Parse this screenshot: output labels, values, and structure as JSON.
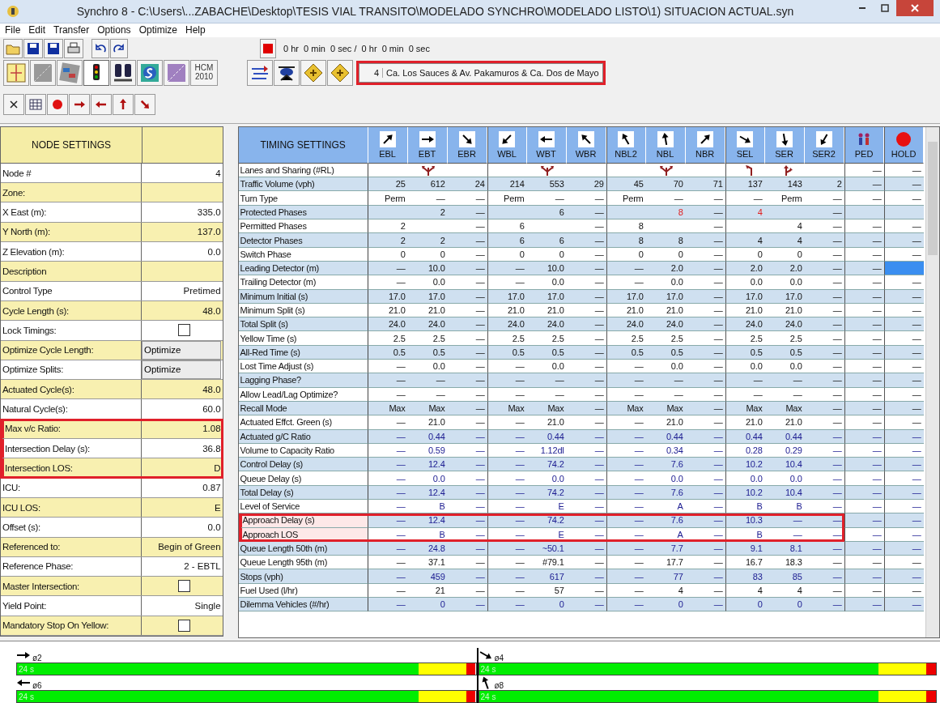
{
  "window": {
    "title": "Synchro 8 - C:\\Users\\...ZABACHE\\Desktop\\TESIS VIAL TRANSITO\\MODELADO SYNCHRO\\MODELADO LISTO\\1) SITUACION ACTUAL.syn"
  },
  "menu": [
    {
      "label": "File"
    },
    {
      "label": "Edit"
    },
    {
      "label": "Transfer"
    },
    {
      "label": "Options"
    },
    {
      "label": "Optimize"
    },
    {
      "label": "Help"
    }
  ],
  "toolbar": {
    "status_time": "0 hr  0 min  0 sec /  0 hr  0 min  0 sec",
    "hcm": "HCM 2010",
    "node_number": "4",
    "node_name": "Ca. Los Sauces & Av. Pakamuros & Ca. Dos de Mayo",
    "node_highlighted": true
  },
  "node_settings": {
    "title": "NODE SETTINGS",
    "rows": [
      {
        "label": "Node #",
        "kind": "value",
        "value": "4",
        "highlighted": false
      },
      {
        "label": "Zone:",
        "kind": "field",
        "highlighted": false
      },
      {
        "label": "X East (m):",
        "kind": "value",
        "value": "335.0",
        "highlighted": false
      },
      {
        "label": "Y North (m):",
        "kind": "value",
        "value": "137.0",
        "highlighted": false
      },
      {
        "label": "Z Elevation (m):",
        "kind": "value",
        "value": "0.0",
        "highlighted": false
      },
      {
        "label": "Description",
        "kind": "field",
        "highlighted": false
      },
      {
        "label": "Control Type",
        "kind": "value",
        "value": "Pretimed",
        "highlighted": false
      },
      {
        "label": "Cycle Length (s):",
        "kind": "value",
        "value": "48.0",
        "highlighted": false
      },
      {
        "label": "Lock Timings:",
        "kind": "checkbox",
        "checked": false,
        "highlighted": false
      },
      {
        "label": "Optimize Cycle Length:",
        "kind": "button",
        "value": "Optimize",
        "highlighted": false
      },
      {
        "label": "Optimize Splits:",
        "kind": "button",
        "value": "Optimize",
        "highlighted": false
      },
      {
        "label": "Actuated Cycle(s):",
        "kind": "value",
        "value": "48.0",
        "highlighted": false
      },
      {
        "label": "Natural Cycle(s):",
        "kind": "value",
        "value": "60.0",
        "highlighted": false
      },
      {
        "label": "Max v/c Ratio:",
        "kind": "value",
        "value": "1.08",
        "highlighted": true
      },
      {
        "label": "Intersection Delay (s):",
        "kind": "value",
        "value": "36.8",
        "highlighted": true
      },
      {
        "label": "Intersection LOS:",
        "kind": "value",
        "value": "D",
        "highlighted": true
      },
      {
        "label": "ICU:",
        "kind": "value",
        "value": "0.87",
        "highlighted": false
      },
      {
        "label": "ICU LOS:",
        "kind": "value",
        "value": "E",
        "highlighted": false
      },
      {
        "label": "Offset (s):",
        "kind": "value",
        "value": "0.0",
        "highlighted": false
      },
      {
        "label": "Referenced to:",
        "kind": "value",
        "value": "Begin of Green",
        "highlighted": false
      },
      {
        "label": "Reference Phase:",
        "kind": "value",
        "value": "2 - EBTL",
        "highlighted": false
      },
      {
        "label": "Master Intersection:",
        "kind": "checkbox",
        "checked": false,
        "highlighted": false
      },
      {
        "label": "Yield Point:",
        "kind": "value",
        "value": "Single",
        "highlighted": false
      },
      {
        "label": "Mandatory Stop On Yellow:",
        "kind": "checkbox",
        "checked": false,
        "highlighted": false
      }
    ]
  },
  "timing": {
    "title": "TIMING SETTINGS",
    "columns": [
      "EBL",
      "EBT",
      "EBR",
      "WBL",
      "WBT",
      "WBR",
      "NBL2",
      "NBL",
      "NBR",
      "SEL",
      "SER",
      "SER2",
      "PED",
      "HOLD"
    ],
    "rows": [
      {
        "label": "Lanes and Sharing (#RL)",
        "calculated": false,
        "highlighted": false,
        "cells": [
          null,
          {
            "kind": "ltr"
          },
          null,
          null,
          {
            "kind": "ltr"
          },
          null,
          null,
          {
            "kind": "ltr"
          },
          null,
          {
            "kind": "l"
          },
          {
            "kind": "tr"
          },
          null,
          "—",
          "—"
        ]
      },
      {
        "label": "Traffic Volume (vph)",
        "calculated": false,
        "highlighted": false,
        "cells": [
          "25",
          "612",
          "24",
          "214",
          "553",
          "29",
          "45",
          "70",
          "71",
          "137",
          "143",
          "2",
          "—",
          "—"
        ]
      },
      {
        "label": "Turn Type",
        "calculated": false,
        "highlighted": false,
        "cells": [
          "Perm",
          "—",
          "—",
          "Perm",
          "—",
          "—",
          "Perm",
          "—",
          "—",
          "—",
          "Perm",
          "—",
          "—",
          "—"
        ]
      },
      {
        "label": "Protected Phases",
        "calculated": false,
        "highlighted": false,
        "cells": [
          null,
          "2",
          "—",
          null,
          "6",
          "—",
          null,
          {
            "text": "8",
            "warning": true
          },
          "—",
          {
            "text": "4",
            "warning": true
          },
          null,
          "—",
          null,
          null
        ]
      },
      {
        "label": "Permitted Phases",
        "calculated": false,
        "highlighted": false,
        "cells": [
          "2",
          null,
          "—",
          "6",
          null,
          "—",
          "8",
          null,
          "—",
          null,
          "4",
          "—",
          "—",
          "—"
        ]
      },
      {
        "label": "Detector Phases",
        "calculated": false,
        "highlighted": false,
        "cells": [
          "2",
          "2",
          "—",
          "6",
          "6",
          "—",
          "8",
          "8",
          "—",
          "4",
          "4",
          "—",
          "—",
          "—"
        ]
      },
      {
        "label": "Switch Phase",
        "calculated": false,
        "highlighted": false,
        "cells": [
          "0",
          "0",
          "—",
          "0",
          "0",
          "—",
          "0",
          "0",
          "—",
          "0",
          "0",
          "—",
          "—",
          "—"
        ]
      },
      {
        "label": "Leading Detector (m)",
        "calculated": false,
        "highlighted": false,
        "cells": [
          "—",
          "10.0",
          "—",
          "—",
          "10.0",
          "—",
          "—",
          "2.0",
          "—",
          "2.0",
          "2.0",
          "—",
          "—",
          {
            "selected": true
          }
        ]
      },
      {
        "label": "Trailing Detector (m)",
        "calculated": false,
        "highlighted": false,
        "cells": [
          "—",
          "0.0",
          "—",
          "—",
          "0.0",
          "—",
          "—",
          "0.0",
          "—",
          "0.0",
          "0.0",
          "—",
          "—",
          "—"
        ]
      },
      {
        "label": "Minimum Initial (s)",
        "calculated": false,
        "highlighted": false,
        "cells": [
          "17.0",
          "17.0",
          "—",
          "17.0",
          "17.0",
          "—",
          "17.0",
          "17.0",
          "—",
          "17.0",
          "17.0",
          "—",
          "—",
          "—"
        ]
      },
      {
        "label": "Minimum Split (s)",
        "calculated": false,
        "highlighted": false,
        "cells": [
          "21.0",
          "21.0",
          "—",
          "21.0",
          "21.0",
          "—",
          "21.0",
          "21.0",
          "—",
          "21.0",
          "21.0",
          "—",
          "—",
          "—"
        ]
      },
      {
        "label": "Total Split (s)",
        "calculated": false,
        "highlighted": false,
        "cells": [
          "24.0",
          "24.0",
          "—",
          "24.0",
          "24.0",
          "—",
          "24.0",
          "24.0",
          "—",
          "24.0",
          "24.0",
          "—",
          "—",
          "—"
        ]
      },
      {
        "label": "Yellow Time (s)",
        "calculated": false,
        "highlighted": false,
        "cells": [
          "2.5",
          "2.5",
          "—",
          "2.5",
          "2.5",
          "—",
          "2.5",
          "2.5",
          "—",
          "2.5",
          "2.5",
          "—",
          "—",
          "—"
        ]
      },
      {
        "label": "All-Red Time (s)",
        "calculated": false,
        "highlighted": false,
        "cells": [
          "0.5",
          "0.5",
          "—",
          "0.5",
          "0.5",
          "—",
          "0.5",
          "0.5",
          "—",
          "0.5",
          "0.5",
          "—",
          "—",
          "—"
        ]
      },
      {
        "label": "Lost Time Adjust (s)",
        "calculated": false,
        "highlighted": false,
        "cells": [
          "—",
          "0.0",
          "—",
          "—",
          "0.0",
          "—",
          "—",
          "0.0",
          "—",
          "0.0",
          "0.0",
          "—",
          "—",
          "—"
        ]
      },
      {
        "label": "Lagging Phase?",
        "calculated": false,
        "highlighted": false,
        "cells": [
          "—",
          "—",
          "—",
          "—",
          "—",
          "—",
          "—",
          "—",
          "—",
          "—",
          "—",
          "—",
          "—",
          "—"
        ]
      },
      {
        "label": "Allow Lead/Lag Optimize?",
        "calculated": false,
        "highlighted": false,
        "cells": [
          "—",
          "—",
          "—",
          "—",
          "—",
          "—",
          "—",
          "—",
          "—",
          "—",
          "—",
          "—",
          "—",
          "—"
        ]
      },
      {
        "label": "Recall Mode",
        "calculated": false,
        "highlighted": false,
        "cells": [
          "Max",
          "Max",
          "—",
          "Max",
          "Max",
          "—",
          "Max",
          "Max",
          "—",
          "Max",
          "Max",
          "—",
          "—",
          "—"
        ]
      },
      {
        "label": "Actuated Effct. Green (s)",
        "calculated": false,
        "highlighted": false,
        "cells": [
          "—",
          "21.0",
          "—",
          "—",
          "21.0",
          "—",
          "—",
          "21.0",
          "—",
          "21.0",
          "21.0",
          "—",
          "—",
          "—"
        ]
      },
      {
        "label": "Actuated g/C Ratio",
        "calculated": true,
        "highlighted": false,
        "cells": [
          "—",
          "0.44",
          "—",
          "—",
          "0.44",
          "—",
          "—",
          "0.44",
          "—",
          "0.44",
          "0.44",
          "—",
          "—",
          "—"
        ]
      },
      {
        "label": "Volume to Capacity Ratio",
        "calculated": true,
        "highlighted": false,
        "cells": [
          "—",
          "0.59",
          "—",
          "—",
          "1.12dl",
          "—",
          "—",
          "0.34",
          "—",
          "0.28",
          "0.29",
          "—",
          "—",
          "—"
        ]
      },
      {
        "label": "Control Delay (s)",
        "calculated": true,
        "highlighted": false,
        "cells": [
          "—",
          "12.4",
          "—",
          "—",
          "74.2",
          "—",
          "—",
          "7.6",
          "—",
          "10.2",
          "10.4",
          "—",
          "—",
          "—"
        ]
      },
      {
        "label": "Queue Delay (s)",
        "calculated": true,
        "highlighted": false,
        "cells": [
          "—",
          "0.0",
          "—",
          "—",
          "0.0",
          "—",
          "—",
          "0.0",
          "—",
          "0.0",
          "0.0",
          "—",
          "—",
          "—"
        ]
      },
      {
        "label": "Total Delay (s)",
        "calculated": true,
        "highlighted": false,
        "cells": [
          "—",
          "12.4",
          "—",
          "—",
          "74.2",
          "—",
          "—",
          "7.6",
          "—",
          "10.2",
          "10.4",
          "—",
          "—",
          "—"
        ]
      },
      {
        "label": "Level of Service",
        "calculated": true,
        "highlighted": false,
        "cells": [
          "—",
          "B",
          "—",
          "—",
          "E",
          "—",
          "—",
          "A",
          "—",
          "B",
          "B",
          "—",
          "—",
          "—"
        ]
      },
      {
        "label": "Approach Delay (s)",
        "calculated": true,
        "highlighted": true,
        "cells": [
          "—",
          "12.4",
          "—",
          "—",
          "74.2",
          "—",
          "—",
          "7.6",
          "—",
          "10.3",
          "—",
          "—",
          "—",
          "—"
        ]
      },
      {
        "label": "Approach LOS",
        "calculated": true,
        "highlighted": true,
        "cells": [
          "—",
          "B",
          "—",
          "—",
          "E",
          "—",
          "—",
          "A",
          "—",
          "B",
          "—",
          "—",
          "—",
          "—"
        ]
      },
      {
        "label": "Queue Length 50th (m)",
        "calculated": true,
        "highlighted": false,
        "cells": [
          "—",
          "24.8",
          "—",
          "—",
          "~50.1",
          "—",
          "—",
          "7.7",
          "—",
          "9.1",
          "8.1",
          "—",
          "—",
          "—"
        ]
      },
      {
        "label": "Queue Length 95th (m)",
        "calculated": false,
        "highlighted": false,
        "cells": [
          "—",
          "37.1",
          "—",
          "—",
          "#79.1",
          "—",
          "—",
          "17.7",
          "—",
          "16.7",
          "18.3",
          "—",
          "—",
          "—"
        ]
      },
      {
        "label": "Stops (vph)",
        "calculated": true,
        "highlighted": false,
        "cells": [
          "—",
          "459",
          "—",
          "—",
          "617",
          "—",
          "—",
          "77",
          "—",
          "83",
          "85",
          "—",
          "—",
          "—"
        ]
      },
      {
        "label": "Fuel Used (l/hr)",
        "calculated": false,
        "highlighted": false,
        "cells": [
          "—",
          "21",
          "—",
          "—",
          "57",
          "—",
          "—",
          "4",
          "—",
          "4",
          "4",
          "—",
          "—",
          "—"
        ]
      },
      {
        "label": "Dilemma Vehicles (#/hr)",
        "calculated": true,
        "highlighted": false,
        "cells": [
          "—",
          "0",
          "—",
          "—",
          "0",
          "—",
          "—",
          "0",
          "—",
          "0",
          "0",
          "—",
          "—",
          "—"
        ]
      }
    ]
  },
  "phases": [
    {
      "label": "ø2",
      "duration": "24 s",
      "level": 0.875
    },
    {
      "label": "ø4",
      "duration": "24 s",
      "level": 0.875
    },
    {
      "label": "ø6",
      "duration": "24 s",
      "level": 0.875
    },
    {
      "label": "ø8",
      "duration": "24 s",
      "level": 0.875
    }
  ]
}
